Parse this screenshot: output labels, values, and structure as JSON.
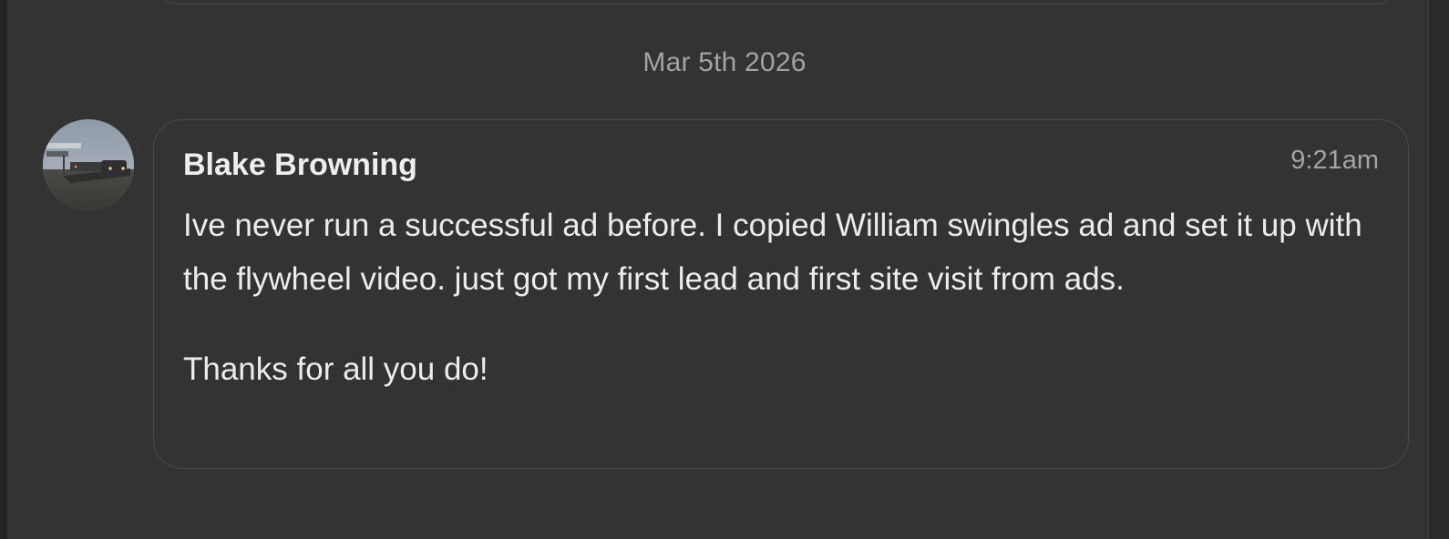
{
  "date_separator": "Mar 5th 2026",
  "message": {
    "sender": "Blake Browning",
    "time": "9:21am",
    "paragraphs": [
      "Ive never run a successful ad before. I copied William swingles ad and set it up with the flywheel video. just got my first lead and first site visit from ads.",
      "Thanks for all you do!"
    ]
  },
  "colors": {
    "background": "#333333",
    "card_border": "#4b4b4b",
    "text_primary": "#ececec",
    "text_muted": "#a3a3a3"
  }
}
